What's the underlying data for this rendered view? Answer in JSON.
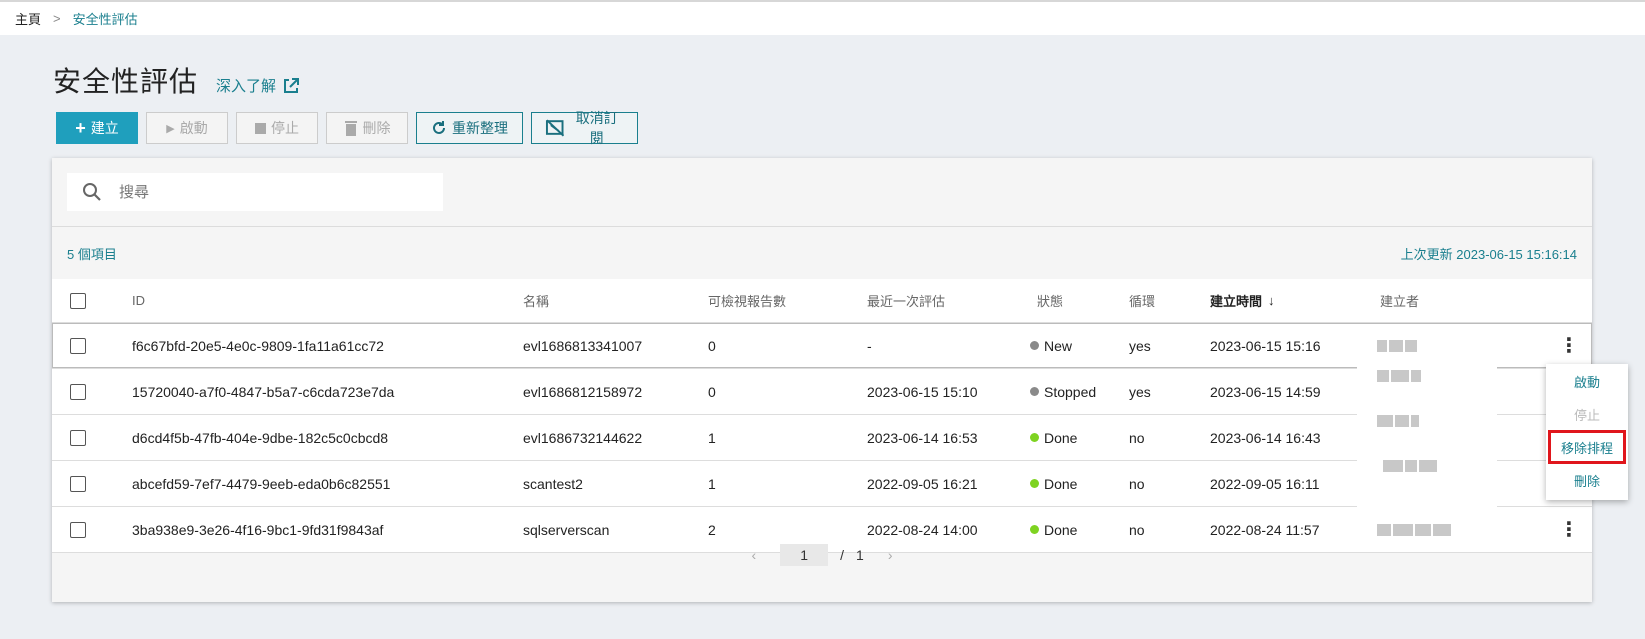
{
  "breadcrumb": {
    "home": "主頁",
    "separator": ">",
    "current": "安全性評估"
  },
  "page": {
    "title": "安全性評估",
    "learn_more": "深入了解"
  },
  "toolbar": {
    "create": "建立",
    "start": "啟動",
    "stop": "停止",
    "delete": "刪除",
    "refresh": "重新整理",
    "unsubscribe": "取消訂閱"
  },
  "search": {
    "placeholder": "搜尋"
  },
  "summary": {
    "count": "5 個項目",
    "last_updated": "上次更新 2023-06-15 15:16:14"
  },
  "table": {
    "headers": {
      "id": "ID",
      "name": "名稱",
      "reports": "可檢視報告數",
      "last_eval": "最近一次評估",
      "status": "狀態",
      "recurring": "循環",
      "created": "建立時間",
      "creator": "建立者"
    },
    "rows": [
      {
        "id": "f6c67bfd-20e5-4e0c-9809-1fa11a61cc72",
        "name": "evl1686813341007",
        "reports": "0",
        "last_eval": "-",
        "status": "New",
        "recurring": "yes",
        "created": "2023-06-15 15:16"
      },
      {
        "id": "15720040-a7f0-4847-b5a7-c6cda723e7da",
        "name": "evl1686812158972",
        "reports": "0",
        "last_eval": "2023-06-15 15:10",
        "status": "Stopped",
        "recurring": "yes",
        "created": "2023-06-15 14:59"
      },
      {
        "id": "d6cd4f5b-47fb-404e-9dbe-182c5c0cbcd8",
        "name": "evl1686732144622",
        "reports": "1",
        "last_eval": "2023-06-14 16:53",
        "status": "Done",
        "recurring": "no",
        "created": "2023-06-14 16:43"
      },
      {
        "id": "abcefd59-7ef7-4479-9eeb-eda0b6c82551",
        "name": "scantest2",
        "reports": "1",
        "last_eval": "2022-09-05 16:21",
        "status": "Done",
        "recurring": "no",
        "created": "2022-09-05 16:11"
      },
      {
        "id": "3ba938e9-3e26-4f16-9bc1-9fd31f9843af",
        "name": "sqlserverscan",
        "reports": "2",
        "last_eval": "2022-08-24 14:00",
        "status": "Done",
        "recurring": "no",
        "created": "2022-08-24 11:57"
      }
    ]
  },
  "pagination": {
    "current": "1",
    "separator": "/",
    "total": "1"
  },
  "row_menu": {
    "start": "啟動",
    "stop": "停止",
    "remove_schedule": "移除排程",
    "delete": "刪除"
  },
  "colors": {
    "accent": "#1a7f8e",
    "primary_button": "#1f9fbd",
    "status_gray": "#8a8a8a",
    "status_green": "#7ed321",
    "highlight_red": "#e0161c"
  }
}
